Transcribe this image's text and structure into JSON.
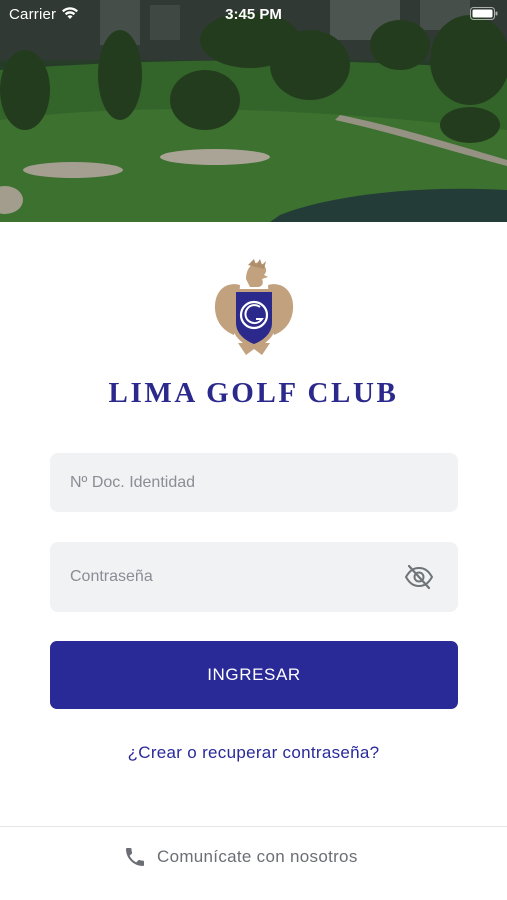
{
  "status_bar": {
    "carrier": "Carrier",
    "time": "3:45 PM",
    "icons": [
      "wifi-icon",
      "battery-icon"
    ]
  },
  "hero": {
    "image": "golf-course-photo"
  },
  "brand": {
    "name": "LIMA GOLF CLUB",
    "logo": "lima-golf-club-crest",
    "color": "#2b2a8c"
  },
  "login_form": {
    "document_placeholder": "Nº Doc. Identidad",
    "document_value": "",
    "password_placeholder": "Contraseña",
    "password_value": "",
    "toggle_icon": "eye-slash-icon",
    "submit_label": "INGRESAR",
    "submit_color": "#2a2998"
  },
  "recover_link": "¿Crear o recuperar contraseña?",
  "footer": {
    "contact_icon": "phone-icon",
    "contact_label": "Comunícate con nosotros"
  }
}
